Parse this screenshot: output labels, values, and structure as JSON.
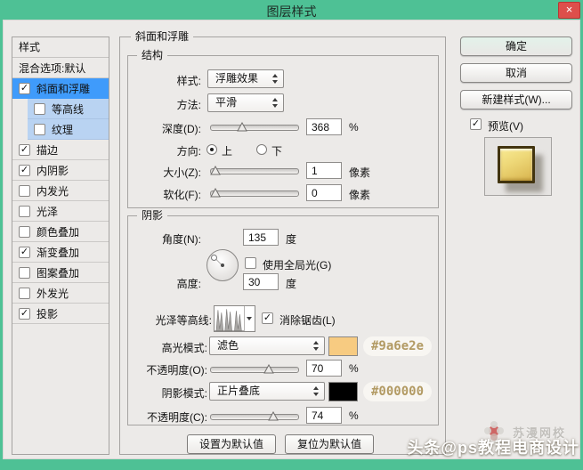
{
  "window": {
    "title": "图层样式",
    "close_glyph": "×"
  },
  "sidebar": {
    "header": "样式",
    "blending": "混合选项:默认",
    "items": [
      {
        "label": "斜面和浮雕",
        "checked": true,
        "variant": "selected"
      },
      {
        "label": "等高线",
        "checked": false,
        "variant": "sub"
      },
      {
        "label": "纹理",
        "checked": false,
        "variant": "sub"
      },
      {
        "label": "描边",
        "checked": true,
        "variant": ""
      },
      {
        "label": "内阴影",
        "checked": true,
        "variant": ""
      },
      {
        "label": "内发光",
        "checked": false,
        "variant": ""
      },
      {
        "label": "光泽",
        "checked": false,
        "variant": ""
      },
      {
        "label": "颜色叠加",
        "checked": false,
        "variant": ""
      },
      {
        "label": "渐变叠加",
        "checked": true,
        "variant": ""
      },
      {
        "label": "图案叠加",
        "checked": false,
        "variant": ""
      },
      {
        "label": "外发光",
        "checked": false,
        "variant": ""
      },
      {
        "label": "投影",
        "checked": true,
        "variant": ""
      }
    ]
  },
  "main": {
    "title": "斜面和浮雕",
    "structure": {
      "legend": "结构",
      "style_label": "样式:",
      "style_value": "浮雕效果",
      "method_label": "方法:",
      "method_value": "平滑",
      "depth_label": "深度(D):",
      "depth_value": "368",
      "depth_unit": "%",
      "direction_label": "方向:",
      "direction_up": "上",
      "direction_down": "下",
      "direction_selected": "up",
      "size_label": "大小(Z):",
      "size_value": "1",
      "size_unit": "像素",
      "soften_label": "软化(F):",
      "soften_value": "0",
      "soften_unit": "像素"
    },
    "shading": {
      "legend": "阴影",
      "angle_label": "角度(N):",
      "angle_value": "135",
      "angle_unit": "度",
      "global_light_label": "使用全局光(G)",
      "global_light_checked": false,
      "altitude_label": "高度:",
      "altitude_value": "30",
      "altitude_unit": "度",
      "contour_label": "光泽等高线:",
      "antialias_label": "消除锯齿(L)",
      "antialias_checked": true,
      "highlight_mode_label": "高光模式:",
      "highlight_mode_value": "滤色",
      "highlight_swatch_color": "#f7cb81",
      "highlight_hex": "#9a6e2e",
      "opacity_highlight_label": "不透明度(O):",
      "opacity_highlight_value": "70",
      "opacity_highlight_unit": "%",
      "shadow_mode_label": "阴影模式:",
      "shadow_mode_value": "正片叠底",
      "shadow_swatch_color": "#000000",
      "shadow_hex": "#000000",
      "opacity_shadow_label": "不透明度(C):",
      "opacity_shadow_value": "74",
      "opacity_shadow_unit": "%"
    },
    "footer": {
      "set_default": "设置为默认值",
      "reset_default": "复位为默认值"
    }
  },
  "actions": {
    "ok": "确定",
    "cancel": "取消",
    "new_style": "新建样式(W)...",
    "preview_label": "预览(V)",
    "preview_checked": true
  },
  "watermark": {
    "main": "头条@ps教程电商设计",
    "faint": "苏漫网校"
  },
  "colors": {
    "titlebar": "#4ec195",
    "dialog_bg": "#eceae8",
    "selected_item": "#3f9bfb",
    "sub_item": "#b9d3f2",
    "close_button": "#dd4f4b",
    "hex_text": "#b29a63"
  }
}
